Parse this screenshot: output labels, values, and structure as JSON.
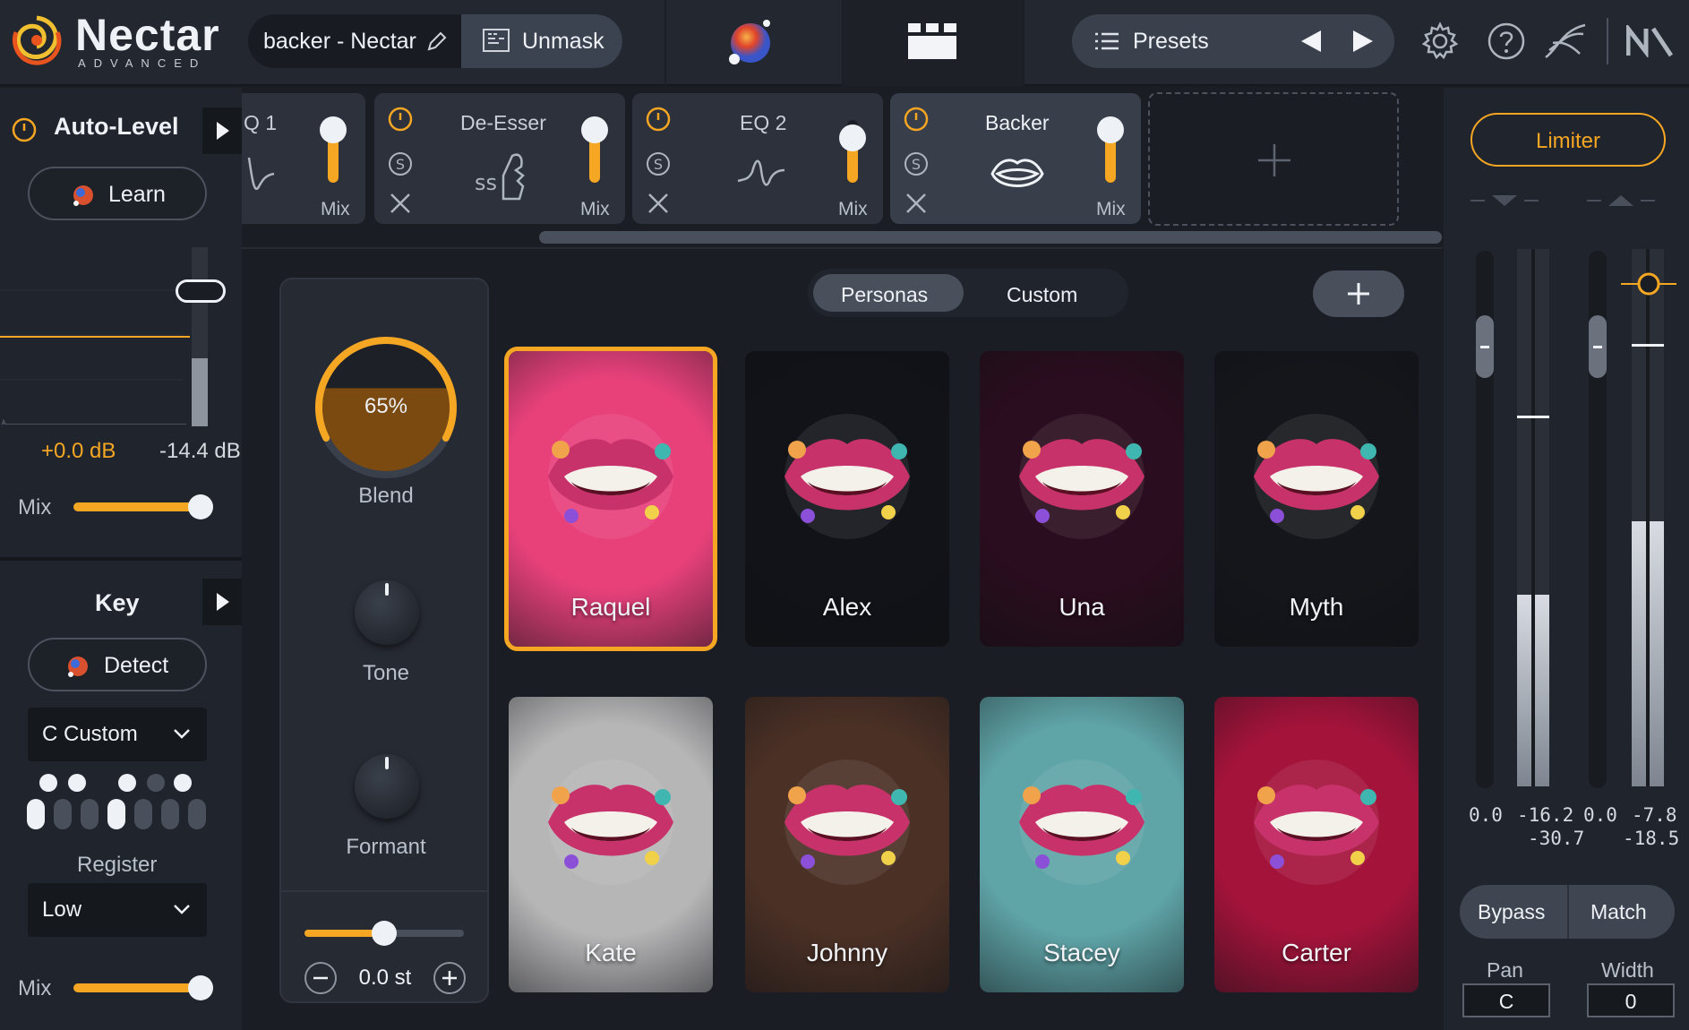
{
  "app": {
    "title": "Nectar",
    "subtitle": "ADVANCED"
  },
  "header": {
    "preset_name": "backer - Nectar",
    "unmask_label": "Unmask",
    "presets_label": "Presets"
  },
  "auto_level": {
    "title": "Auto-Level",
    "learn_label": "Learn",
    "gain_value": "+0.0 dB",
    "level_value": "-14.4 dB",
    "mix_label": "Mix",
    "mix_fraction": 0.92
  },
  "key": {
    "title": "Key",
    "detect_label": "Detect",
    "key_value": "C Custom",
    "register_label": "Register",
    "register_value": "Low",
    "mix_label": "Mix",
    "mix_fraction": 0.92
  },
  "modules": [
    {
      "title": "Q 1",
      "mix_label": "Mix",
      "mix_fraction": 0.85
    },
    {
      "title": "De-Esser",
      "mix_label": "Mix",
      "mix_fraction": 0.85
    },
    {
      "title": "EQ 2",
      "mix_label": "Mix",
      "mix_fraction": 0.72
    },
    {
      "title": "Backer",
      "mix_label": "Mix",
      "mix_fraction": 0.85
    }
  ],
  "backer": {
    "blend_value": "65%",
    "blend_fraction": 0.65,
    "blend_label": "Blend",
    "tone_label": "Tone",
    "formant_label": "Formant",
    "pitch_value": "0.0 st",
    "tabs": [
      "Personas",
      "Custom"
    ],
    "active_tab": "Personas",
    "personas": [
      {
        "name": "Raquel",
        "selected": true,
        "bg": "#e8417a"
      },
      {
        "name": "Alex",
        "selected": false,
        "bg": "#111318"
      },
      {
        "name": "Una",
        "selected": false,
        "bg": "#2a0d1e"
      },
      {
        "name": "Myth",
        "selected": false,
        "bg": "#14161b"
      },
      {
        "name": "Kate",
        "selected": false,
        "bg": "#b7b6b7"
      },
      {
        "name": "Johnny",
        "selected": false,
        "bg": "#4a3025"
      },
      {
        "name": "Stacey",
        "selected": false,
        "bg": "#5fa4a7"
      },
      {
        "name": "Carter",
        "selected": false,
        "bg": "#a3133a"
      }
    ]
  },
  "limiter": {
    "label": "Limiter",
    "in_peak": "0.0",
    "in_val1": "-16.2",
    "in_val2": "-30.7",
    "out_peak": "0.0",
    "out_val1": "-7.8",
    "out_val2": "-18.5",
    "bypass_label": "Bypass",
    "match_label": "Match",
    "pan_label": "Pan",
    "pan_value": "C",
    "width_label": "Width",
    "width_value": "0"
  },
  "colors": {
    "accent": "#f5a623"
  }
}
